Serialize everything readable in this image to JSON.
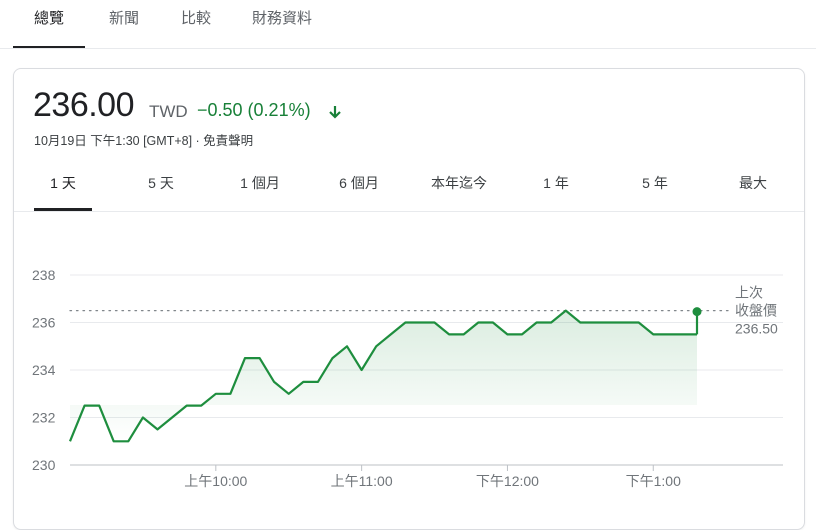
{
  "top_tabs": [
    "總覽",
    "新聞",
    "比較",
    "財務資料"
  ],
  "quote": {
    "price": "236.00",
    "currency": "TWD",
    "change": "−0.50 (0.21%)",
    "timestamp": "10月19日 下午1:30 [GMT+8] · 免責聲明"
  },
  "range_tabs": [
    "1 天",
    "5 天",
    "1 個月",
    "6 個月",
    "本年迄今",
    "1 年",
    "5 年",
    "最大"
  ],
  "colors": {
    "line": "#1e8e3e",
    "change": "#188038",
    "grid": "#e8eaed"
  },
  "chart_data": {
    "type": "line",
    "ylim": [
      230,
      238
    ],
    "y_ticks": [
      "230",
      "232",
      "234",
      "236",
      "238"
    ],
    "x_labels": [
      "上午10:00",
      "上午11:00",
      "下午12:00",
      "下午1:00"
    ],
    "x_label_values": [
      10.0,
      11.0,
      12.0,
      13.0
    ],
    "x_domain": [
      9.0,
      13.5
    ],
    "previous_close": 236.5,
    "previous_close_label_line1": "上次",
    "previous_close_label_line2": "收盤價",
    "previous_close_value": "236.50",
    "series": [
      {
        "x": [
          9.0,
          9.1,
          9.2,
          9.3,
          9.4,
          9.5,
          9.6,
          9.7,
          9.8,
          9.9,
          10.0,
          10.1,
          10.2,
          10.3,
          10.4,
          10.5,
          10.6,
          10.7,
          10.8,
          10.9,
          11.0,
          11.1,
          11.2,
          11.3,
          11.4,
          11.5,
          11.6,
          11.7,
          11.8,
          11.9,
          12.0,
          12.1,
          12.2,
          12.3,
          12.4,
          12.5,
          12.6,
          12.7,
          12.8,
          12.9,
          13.0,
          13.1,
          13.2,
          13.3
        ],
        "y": [
          231.0,
          232.5,
          232.5,
          231.0,
          231.0,
          232.0,
          231.5,
          232.0,
          232.5,
          232.5,
          233.0,
          233.0,
          234.5,
          234.5,
          233.5,
          233.0,
          233.5,
          233.5,
          234.5,
          235.0,
          234.0,
          235.0,
          235.5,
          236.0,
          236.0,
          236.0,
          235.5,
          235.5,
          236.0,
          236.0,
          235.5,
          235.5,
          236.0,
          236.0,
          236.5,
          236.0,
          236.0,
          236.0,
          236.0,
          236.0,
          235.5,
          235.5,
          235.5,
          235.5
        ]
      }
    ]
  }
}
